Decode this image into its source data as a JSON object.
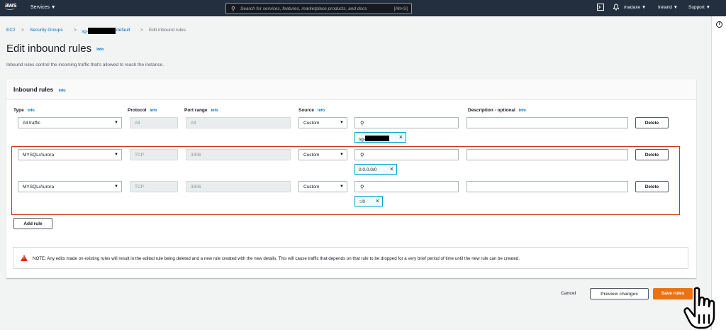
{
  "topnav": {
    "logo": "aws",
    "services": "Services ▼",
    "search_placeholder": "Search for services, features, marketplace products, and docs",
    "search_shortcut": "[Alt+S]",
    "user": "madaxe ▼",
    "region": "Ireland ▼",
    "support": "Support ▼",
    "icons": [
      "search-icon",
      "terminal-icon",
      "bell-icon",
      "info-icon"
    ]
  },
  "breadcrumb": {
    "ec2": "EC2",
    "security_groups": "Security Groups",
    "sg_prefix": "sg-",
    "sg_suffix": "default",
    "current": "Edit inbound rules",
    "sep": ">"
  },
  "page": {
    "title": "Edit inbound rules",
    "info": "Info",
    "subtitle": "Inbound rules control the incoming traffic that's allowed to reach the instance."
  },
  "panel": {
    "title": "Inbound rules",
    "info": "Info",
    "columns": {
      "type": "Type",
      "protocol": "Protocol",
      "port_range": "Port range",
      "source": "Source",
      "description": "Description - optional",
      "info": "Info"
    },
    "rows": [
      {
        "type": "All traffic",
        "protocol": "All",
        "port": "All",
        "source": "Custom",
        "token": "sg-",
        "delete": "Delete"
      },
      {
        "type": "MYSQL/Aurora",
        "protocol": "TCP",
        "port": "3306",
        "source": "Custom",
        "token": "0.0.0.0/0",
        "delete": "Delete"
      },
      {
        "type": "MYSQL/Aurora",
        "protocol": "TCP",
        "port": "3306",
        "source": "Custom",
        "token": "::/0",
        "delete": "Delete"
      }
    ],
    "add_rule": "Add rule"
  },
  "alert": {
    "text": "NOTE: Any edits made on existing rules will result in the edited rule being deleted and a new rule created with the new details. This will cause traffic that depends on that rule to be dropped for a very brief period of time until the new rule can be created."
  },
  "footer": {
    "cancel": "Cancel",
    "preview": "Preview changes",
    "save": "Save rules"
  },
  "colors": {
    "nav": "#232f3e",
    "link": "#0073bb",
    "primary": "#ec7211",
    "highlight": "#d13212",
    "token_border": "#00a1c9"
  }
}
